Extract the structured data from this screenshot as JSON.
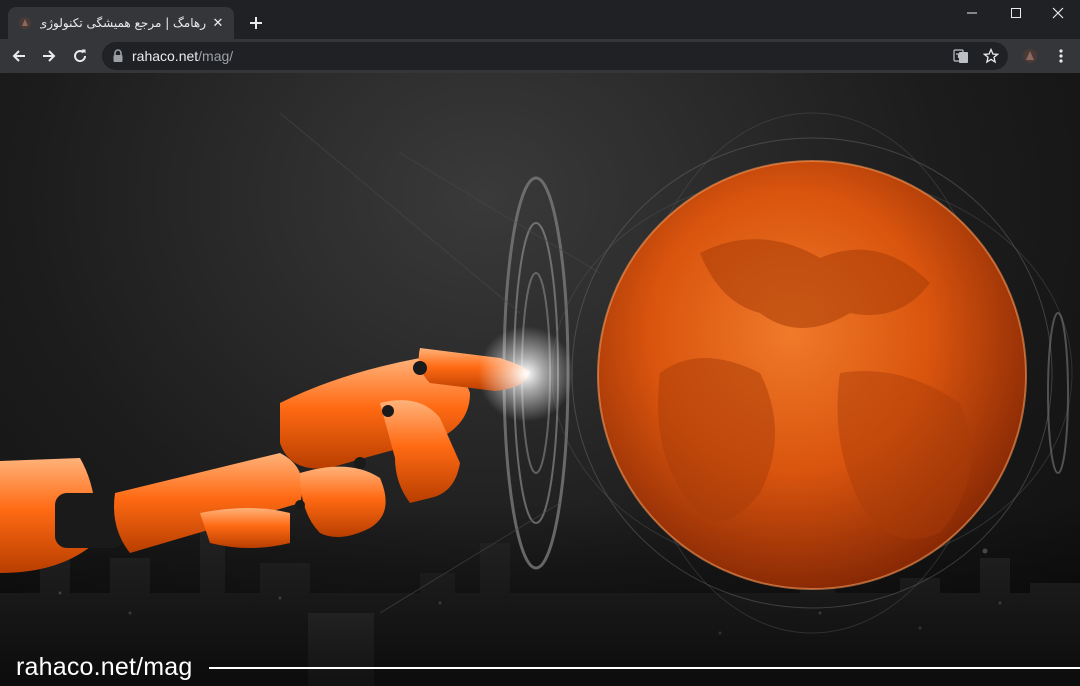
{
  "browser": {
    "tab": {
      "title": "رهامگ | مرجع همیشگی تکنولوژی |",
      "close_glyph": "✕"
    },
    "new_tab_glyph": "+",
    "window_controls": {
      "minimize": "—",
      "maximize": "☐",
      "close": "✕"
    },
    "address": {
      "host": "rahaco.net",
      "path": "/mag/"
    }
  },
  "page": {
    "watermark": "rahaco.net/mag",
    "colors": {
      "accent": "#ff6a13",
      "planet": "#d9540e",
      "background": "#1c1c1c"
    },
    "image_icons": [
      "robot-hand",
      "glowing-planet",
      "holographic-rings",
      "city-skyline"
    ]
  }
}
